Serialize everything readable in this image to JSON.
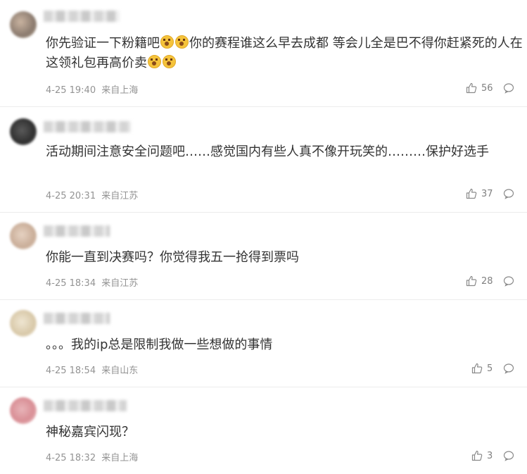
{
  "comments": [
    {
      "text_a": "你先验证一下粉籍吧",
      "text_b": "你的赛程谁这么早去成都 等会儿全是巴不得你赶紧死的人在这领礼包再高价卖",
      "time": "4-25 19:40",
      "location": "来自上海",
      "likes": "56"
    },
    {
      "text": "活动期间注意安全问题吧……感觉国内有些人真不像开玩笑的………保护好选手",
      "time": "4-25 20:31",
      "location": "来自江苏",
      "likes": "37"
    },
    {
      "text": "你能一直到决赛吗？你觉得我五一抢得到票吗",
      "time": "4-25 18:34",
      "location": "来自江苏",
      "likes": "28"
    },
    {
      "text": "。。。我的ip总是限制我做一些想做的事情",
      "time": "4-25 18:54",
      "location": "来自山东",
      "likes": "5"
    },
    {
      "text": "神秘嘉宾闪现？",
      "time": "4-25 18:32",
      "location": "来自上海",
      "likes": "3"
    }
  ],
  "icons": {
    "like": "thumbs-up-icon",
    "reply": "comment-bubble-icon",
    "emoji": "surprised-face-emoji"
  },
  "colors": {
    "text": "#333333",
    "meta": "#939393",
    "divider": "#ececec"
  }
}
